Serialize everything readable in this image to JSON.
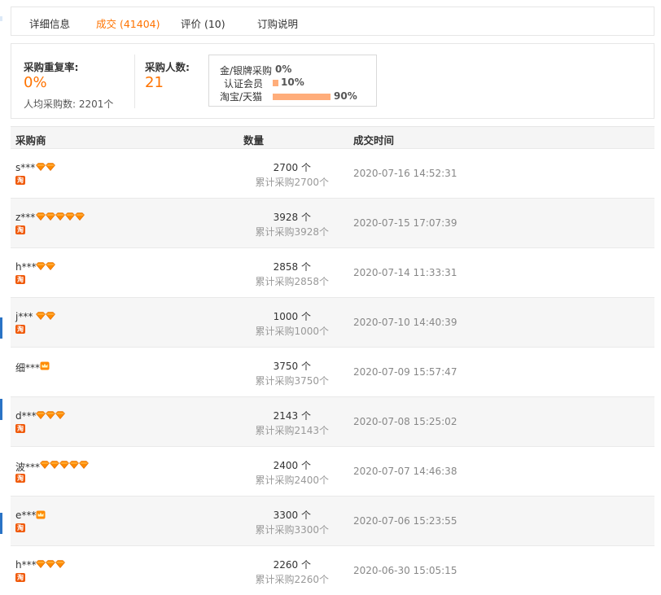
{
  "tabs": [
    {
      "label": "详细信息",
      "active": false
    },
    {
      "label": "成交 (41404)",
      "active": true
    },
    {
      "label": "评价 (10)",
      "active": false
    },
    {
      "label": "订购说明",
      "active": false
    }
  ],
  "summary": {
    "repeat_rate_label": "采购重复率:",
    "repeat_rate_value": "0%",
    "avg_purchase_text": "人均采购数: 2201个",
    "buyers_label": "采购人数:",
    "buyers_value": "21",
    "breakdown": [
      {
        "label": "金/银牌采购",
        "percent": "0%",
        "fraction": 0.0
      },
      {
        "label": "认证会员",
        "percent": "10%",
        "fraction": 0.1
      },
      {
        "label": "淘宝/天猫会员:",
        "percent": "90%",
        "fraction": 0.9
      }
    ]
  },
  "table": {
    "headers": {
      "buyer": "采购商",
      "quantity": "数量",
      "time": "成交时间"
    },
    "rows": [
      {
        "buyer": "s***",
        "badge_type": "diamond",
        "badge_count": 2,
        "taobao": true,
        "quantity": "2700 个",
        "cumulative": "累计采购2700个",
        "time": "2020-07-16 14:52:31"
      },
      {
        "buyer": "z***",
        "badge_type": "diamond",
        "badge_count": 5,
        "taobao": true,
        "quantity": "3928 个",
        "cumulative": "累计采购3928个",
        "time": "2020-07-15 17:07:39"
      },
      {
        "buyer": "h***",
        "badge_type": "diamond",
        "badge_count": 2,
        "taobao": true,
        "quantity": "2858 个",
        "cumulative": "累计采购2858个",
        "time": "2020-07-14 11:33:31"
      },
      {
        "buyer": "j***",
        "badge_type": "diamond",
        "badge_count": 2,
        "taobao": true,
        "quantity": "1000 个",
        "cumulative": "累计采购1000个",
        "time": "2020-07-10 14:40:39"
      },
      {
        "buyer": "细***",
        "badge_type": "crown",
        "badge_count": 1,
        "taobao": false,
        "quantity": "3750 个",
        "cumulative": "累计采购3750个",
        "time": "2020-07-09 15:57:47"
      },
      {
        "buyer": "d***",
        "badge_type": "diamond",
        "badge_count": 3,
        "taobao": true,
        "quantity": "2143 个",
        "cumulative": "累计采购2143个",
        "time": "2020-07-08 15:25:02"
      },
      {
        "buyer": "波***",
        "badge_type": "diamond",
        "badge_count": 5,
        "taobao": true,
        "quantity": "2400 个",
        "cumulative": "累计采购2400个",
        "time": "2020-07-07 14:46:38"
      },
      {
        "buyer": "e***",
        "badge_type": "crown",
        "badge_count": 1,
        "taobao": true,
        "quantity": "3300 个",
        "cumulative": "累计采购3300个",
        "time": "2020-07-06 15:23:55"
      },
      {
        "buyer": "h***",
        "badge_type": "diamond",
        "badge_count": 3,
        "taobao": true,
        "quantity": "2260 个",
        "cumulative": "累计采购2260个",
        "time": "2020-06-30 15:05:15"
      }
    ],
    "taobao_mark": "淘"
  },
  "colors": {
    "accent": "#ff7300",
    "bar": "#ffad7a",
    "badge": "#ff8a00"
  }
}
